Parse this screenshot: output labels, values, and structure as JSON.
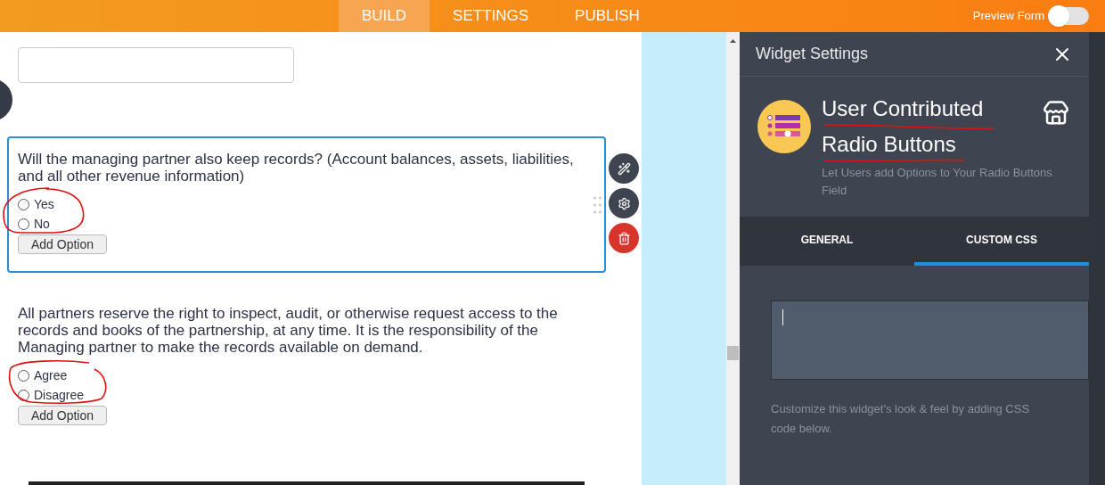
{
  "topbar": {
    "tabs": [
      {
        "label": "BUILD",
        "selected": true
      },
      {
        "label": "SETTINGS",
        "selected": false
      },
      {
        "label": "PUBLISH",
        "selected": false
      }
    ],
    "preview": {
      "label": "Preview Form",
      "on": false
    }
  },
  "form": {
    "questions": [
      {
        "text": "Will the managing partner also keep records? (Account balances, assets, liabilities, and all other revenue information)",
        "active": true,
        "options": [
          {
            "label": "Yes",
            "selected": false
          },
          {
            "label": "No",
            "selected": false
          }
        ],
        "add_button": "Add Option"
      },
      {
        "text": "All partners reserve the right to inspect, audit, or otherwise request access to the records and books of the partnership, at any time. It is the responsibility of the Managing partner to make the records available on demand.",
        "active": false,
        "options": [
          {
            "label": "Agree",
            "selected": false
          },
          {
            "label": "Disagree",
            "selected": false
          }
        ],
        "add_button": "Add Option"
      }
    ]
  },
  "panel": {
    "title": "Widget Settings",
    "widget": {
      "name_lines": [
        "User Contributed",
        "Radio Buttons"
      ],
      "description": "Let Users add Options to Your Radio Buttons Field"
    },
    "tabs": [
      {
        "label": "GENERAL",
        "selected": false
      },
      {
        "label": "CUSTOM CSS",
        "selected": true
      }
    ],
    "css_help": "Customize this widget's look & feel by adding CSS code below."
  }
}
